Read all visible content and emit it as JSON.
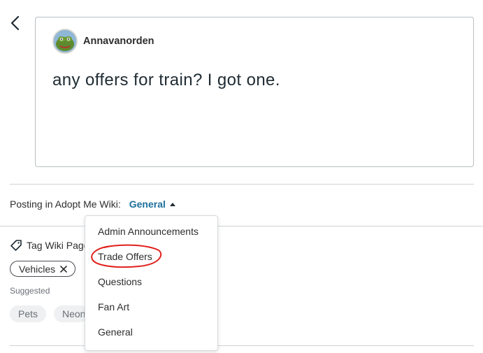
{
  "post": {
    "author": "Annavanorden",
    "text": "any offers for train? I got one."
  },
  "posting": {
    "prefix": "Posting in Adopt Me Wiki:",
    "category": "General"
  },
  "tags": {
    "label": "Tag Wiki Page",
    "selected": [
      "Vehicles"
    ],
    "suggested_label": "Suggested",
    "suggested": [
      "Pets",
      "Neon"
    ]
  },
  "dropdown": {
    "items": [
      "Admin Announcements",
      "Trade Offers",
      "Questions",
      "Fan Art",
      "General"
    ],
    "highlighted": "Trade Offers"
  },
  "colors": {
    "link": "#1c6f9c",
    "annotation": "#e0201b"
  }
}
